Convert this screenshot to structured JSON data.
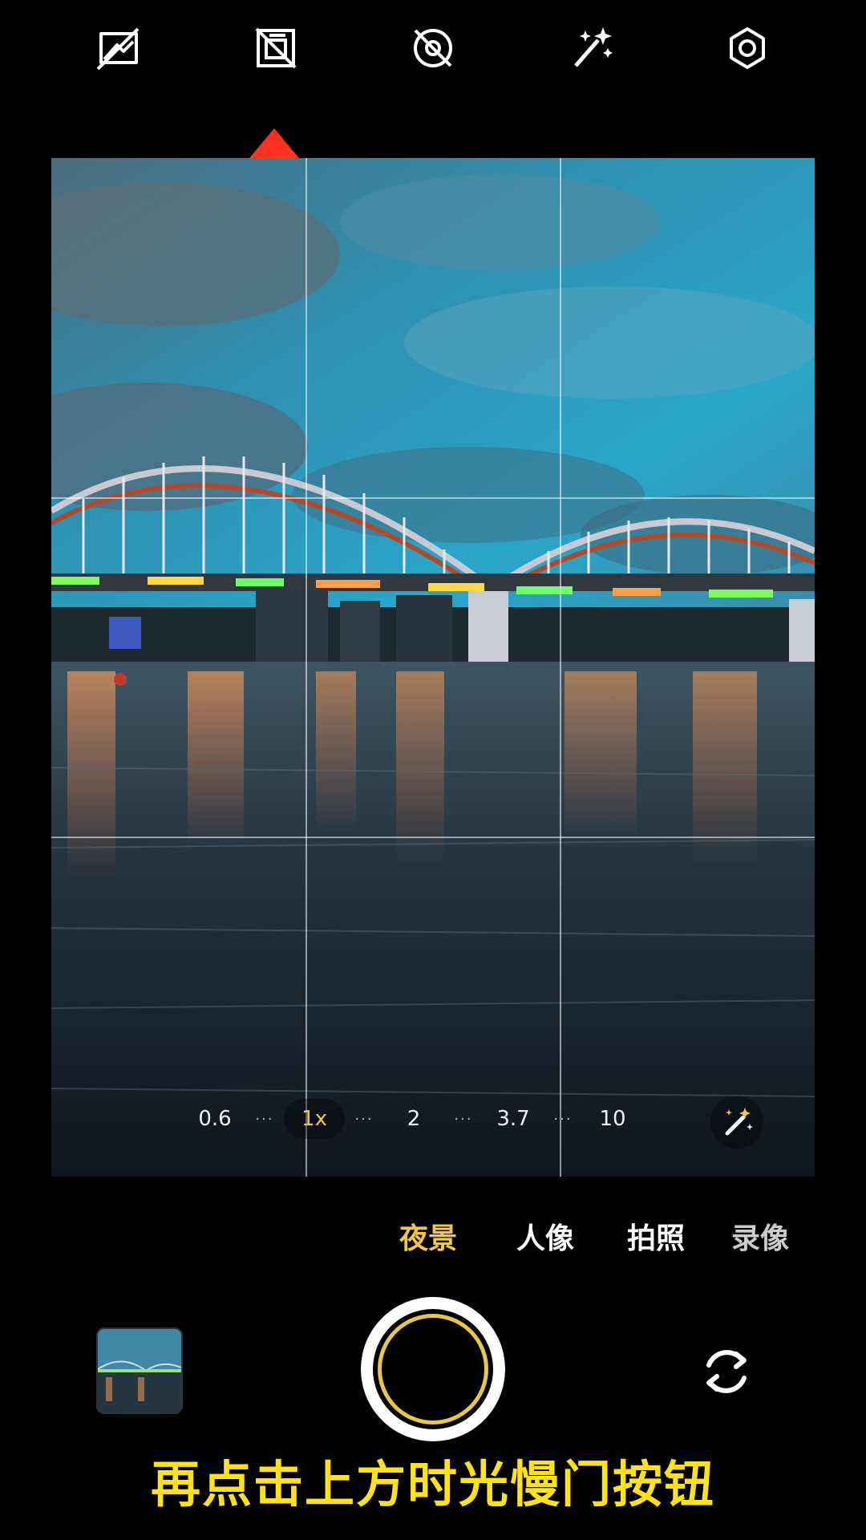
{
  "top_bar": {
    "icons": [
      {
        "name": "flash-off-icon"
      },
      {
        "name": "live-photo-off-icon"
      },
      {
        "name": "timer-off-icon"
      },
      {
        "name": "ai-enhance-icon"
      },
      {
        "name": "settings-icon"
      }
    ]
  },
  "colors": {
    "accent": "#f3c84a",
    "caption": "#ffe21a",
    "arrow": "#ff3b22"
  },
  "zoom": {
    "levels": [
      "0.6",
      "1x",
      "2",
      "3.7",
      "10"
    ],
    "active": "1x",
    "separator": "···"
  },
  "modes": {
    "items": [
      "夜景",
      "人像",
      "拍照",
      "录像"
    ],
    "active": "夜景"
  },
  "caption": "再点击上方时光慢门按钮"
}
